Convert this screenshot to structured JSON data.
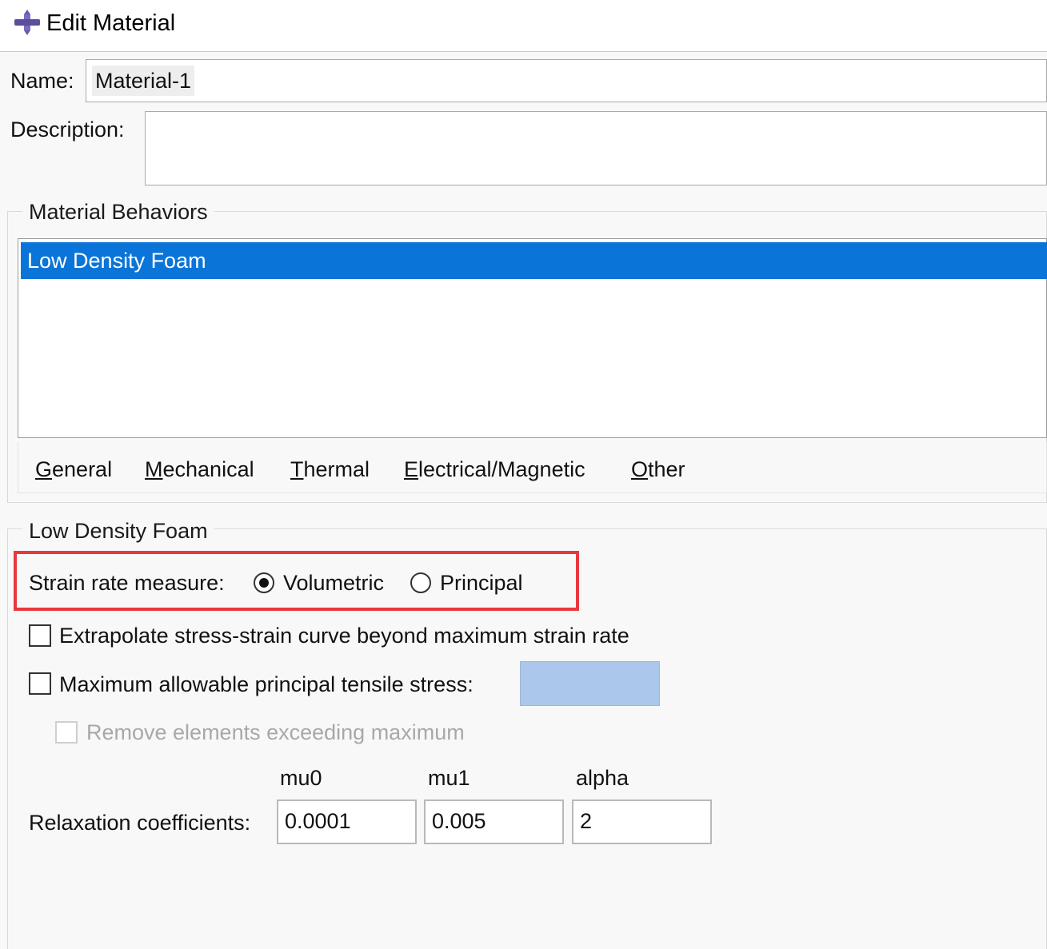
{
  "window": {
    "title": "Edit Material",
    "icon": "material-app-icon"
  },
  "form": {
    "name_label": "Name:",
    "name_value": "Material-1",
    "description_label": "Description:",
    "description_value": ""
  },
  "behaviors": {
    "group_title": "Material Behaviors",
    "items": [
      {
        "label": "Low Density Foam",
        "selected": true
      }
    ]
  },
  "menubar": {
    "items": [
      {
        "label": "General",
        "mnemonic": "G",
        "rest": "eneral"
      },
      {
        "label": "Mechanical",
        "mnemonic": "M",
        "rest": "echanical"
      },
      {
        "label": "Thermal",
        "mnemonic": "T",
        "rest": "hermal"
      },
      {
        "label": "Electrical/Magnetic",
        "mnemonic": "E",
        "rest": "lectrical/Magnetic"
      },
      {
        "label": "Other",
        "mnemonic": "O",
        "rest": "ther"
      }
    ]
  },
  "foam": {
    "group_title": "Low Density Foam",
    "strain_rate_label": "Strain rate measure:",
    "option_volumetric": "Volumetric",
    "option_principal": "Principal",
    "selected_option": "Volumetric",
    "extrapolate_label": "Extrapolate stress-strain curve beyond maximum strain rate",
    "extrapolate_checked": false,
    "max_stress_label": "Maximum allowable principal tensile stress:",
    "max_stress_checked": false,
    "max_stress_value": "",
    "remove_elements_label": "Remove elements exceeding maximum",
    "remove_elements_checked": false,
    "relaxation_label": "Relaxation coefficients:",
    "columns": [
      "mu0",
      "mu1",
      "alpha"
    ],
    "values": [
      "0.0001",
      "0.005",
      "2"
    ]
  },
  "colors": {
    "selection": "#0a74d8",
    "highlight_box": "#e8383d",
    "disabled_field": "#abc8ec"
  }
}
